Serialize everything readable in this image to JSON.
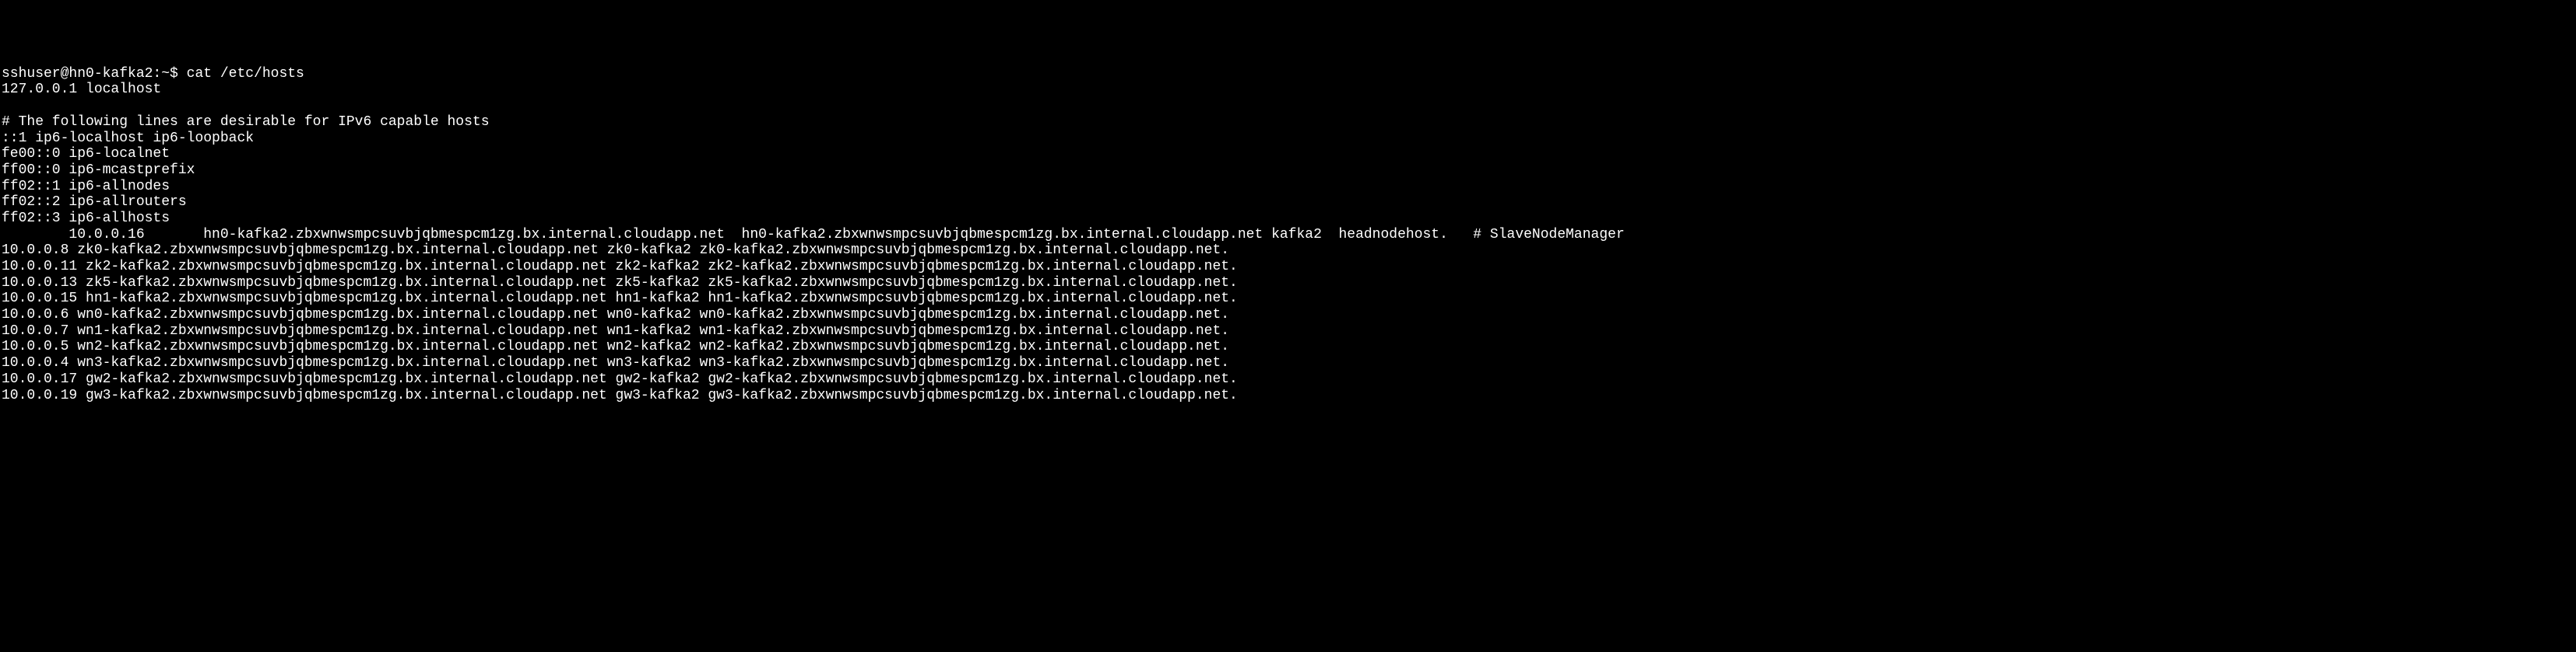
{
  "prompt": "sshuser@hn0-kafka2:~$ cat /etc/hosts",
  "lines": [
    "127.0.0.1 localhost",
    "",
    "# The following lines are desirable for IPv6 capable hosts",
    "::1 ip6-localhost ip6-loopback",
    "fe00::0 ip6-localnet",
    "ff00::0 ip6-mcastprefix",
    "ff02::1 ip6-allnodes",
    "ff02::2 ip6-allrouters",
    "ff02::3 ip6-allhosts",
    "        10.0.0.16       hn0-kafka2.zbxwnwsmpcsuvbjqbmespcm1zg.bx.internal.cloudapp.net  hn0-kafka2.zbxwnwsmpcsuvbjqbmespcm1zg.bx.internal.cloudapp.net kafka2  headnodehost.   # SlaveNodeManager",
    "10.0.0.8 zk0-kafka2.zbxwnwsmpcsuvbjqbmespcm1zg.bx.internal.cloudapp.net zk0-kafka2 zk0-kafka2.zbxwnwsmpcsuvbjqbmespcm1zg.bx.internal.cloudapp.net.",
    "10.0.0.11 zk2-kafka2.zbxwnwsmpcsuvbjqbmespcm1zg.bx.internal.cloudapp.net zk2-kafka2 zk2-kafka2.zbxwnwsmpcsuvbjqbmespcm1zg.bx.internal.cloudapp.net.",
    "10.0.0.13 zk5-kafka2.zbxwnwsmpcsuvbjqbmespcm1zg.bx.internal.cloudapp.net zk5-kafka2 zk5-kafka2.zbxwnwsmpcsuvbjqbmespcm1zg.bx.internal.cloudapp.net.",
    "10.0.0.15 hn1-kafka2.zbxwnwsmpcsuvbjqbmespcm1zg.bx.internal.cloudapp.net hn1-kafka2 hn1-kafka2.zbxwnwsmpcsuvbjqbmespcm1zg.bx.internal.cloudapp.net.",
    "10.0.0.6 wn0-kafka2.zbxwnwsmpcsuvbjqbmespcm1zg.bx.internal.cloudapp.net wn0-kafka2 wn0-kafka2.zbxwnwsmpcsuvbjqbmespcm1zg.bx.internal.cloudapp.net.",
    "10.0.0.7 wn1-kafka2.zbxwnwsmpcsuvbjqbmespcm1zg.bx.internal.cloudapp.net wn1-kafka2 wn1-kafka2.zbxwnwsmpcsuvbjqbmespcm1zg.bx.internal.cloudapp.net.",
    "10.0.0.5 wn2-kafka2.zbxwnwsmpcsuvbjqbmespcm1zg.bx.internal.cloudapp.net wn2-kafka2 wn2-kafka2.zbxwnwsmpcsuvbjqbmespcm1zg.bx.internal.cloudapp.net.",
    "10.0.0.4 wn3-kafka2.zbxwnwsmpcsuvbjqbmespcm1zg.bx.internal.cloudapp.net wn3-kafka2 wn3-kafka2.zbxwnwsmpcsuvbjqbmespcm1zg.bx.internal.cloudapp.net.",
    "10.0.0.17 gw2-kafka2.zbxwnwsmpcsuvbjqbmespcm1zg.bx.internal.cloudapp.net gw2-kafka2 gw2-kafka2.zbxwnwsmpcsuvbjqbmespcm1zg.bx.internal.cloudapp.net.",
    "10.0.0.19 gw3-kafka2.zbxwnwsmpcsuvbjqbmespcm1zg.bx.internal.cloudapp.net gw3-kafka2 gw3-kafka2.zbxwnwsmpcsuvbjqbmespcm1zg.bx.internal.cloudapp.net."
  ]
}
